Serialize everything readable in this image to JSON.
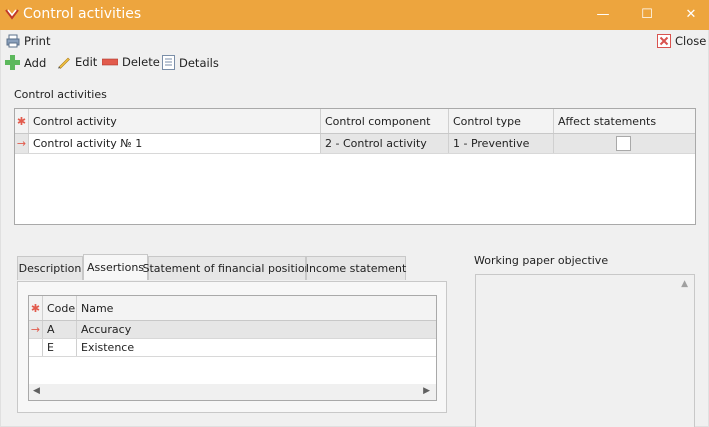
{
  "window": {
    "title": "Control activities",
    "minimize_glyph": "—",
    "maximize_glyph": "☐",
    "close_glyph": "✕"
  },
  "toolbar": {
    "print_label": "Print",
    "add_label": "Add",
    "edit_label": "Edit",
    "delete_label": "Delete",
    "details_label": "Details",
    "close_label": "Close"
  },
  "activities": {
    "section_label": "Control activities",
    "columns": [
      "Control activity",
      "Control component",
      "Control type",
      "Affect statements"
    ],
    "rows": [
      {
        "activity": "Control activity № 1",
        "component": "2 - Control activity",
        "type": "1 - Preventive",
        "affect_statements": false
      }
    ]
  },
  "tabs": {
    "items": [
      "Description",
      "Assertions",
      "Statement of financial position",
      "Income statement"
    ],
    "active": "Assertions"
  },
  "assertions": {
    "columns": [
      "Code",
      "Name"
    ],
    "rows": [
      {
        "code": "A",
        "name": "Accuracy"
      },
      {
        "code": "E",
        "name": "Existence"
      }
    ]
  },
  "objective": {
    "label": "Working paper objective",
    "value": ""
  },
  "colors": {
    "titlebar": "#eda53e",
    "indicator": "#e25b4d",
    "add_icon": "#4caf50",
    "delete_icon": "#e25b4d"
  },
  "icons": [
    "app-icon",
    "print-icon",
    "add-icon",
    "edit-icon",
    "delete-icon",
    "details-icon",
    "close-icon",
    "row-indicator-icon",
    "new-row-icon"
  ]
}
